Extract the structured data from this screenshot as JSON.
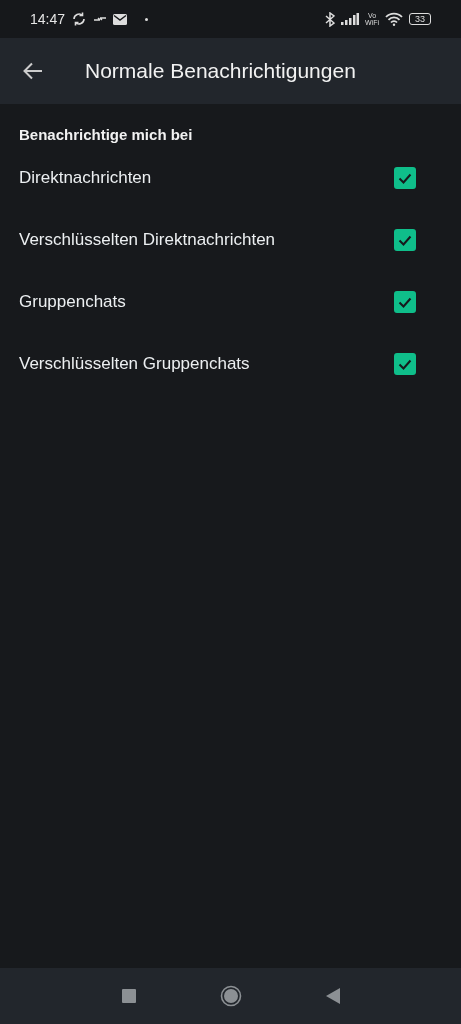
{
  "status_bar": {
    "time": "14:47",
    "vowifi": [
      "Vo",
      "WiFi"
    ],
    "battery": "33"
  },
  "header": {
    "title": "Normale Benachrichtigungen"
  },
  "section": {
    "title": "Benachrichtige mich bei"
  },
  "options": [
    {
      "label": "Direktnachrichten",
      "checked": true
    },
    {
      "label": "Verschlüsselten Direktnachrichten",
      "checked": true
    },
    {
      "label": "Gruppenchats",
      "checked": true
    },
    {
      "label": "Verschlüsselten Gruppenchats",
      "checked": true
    }
  ]
}
